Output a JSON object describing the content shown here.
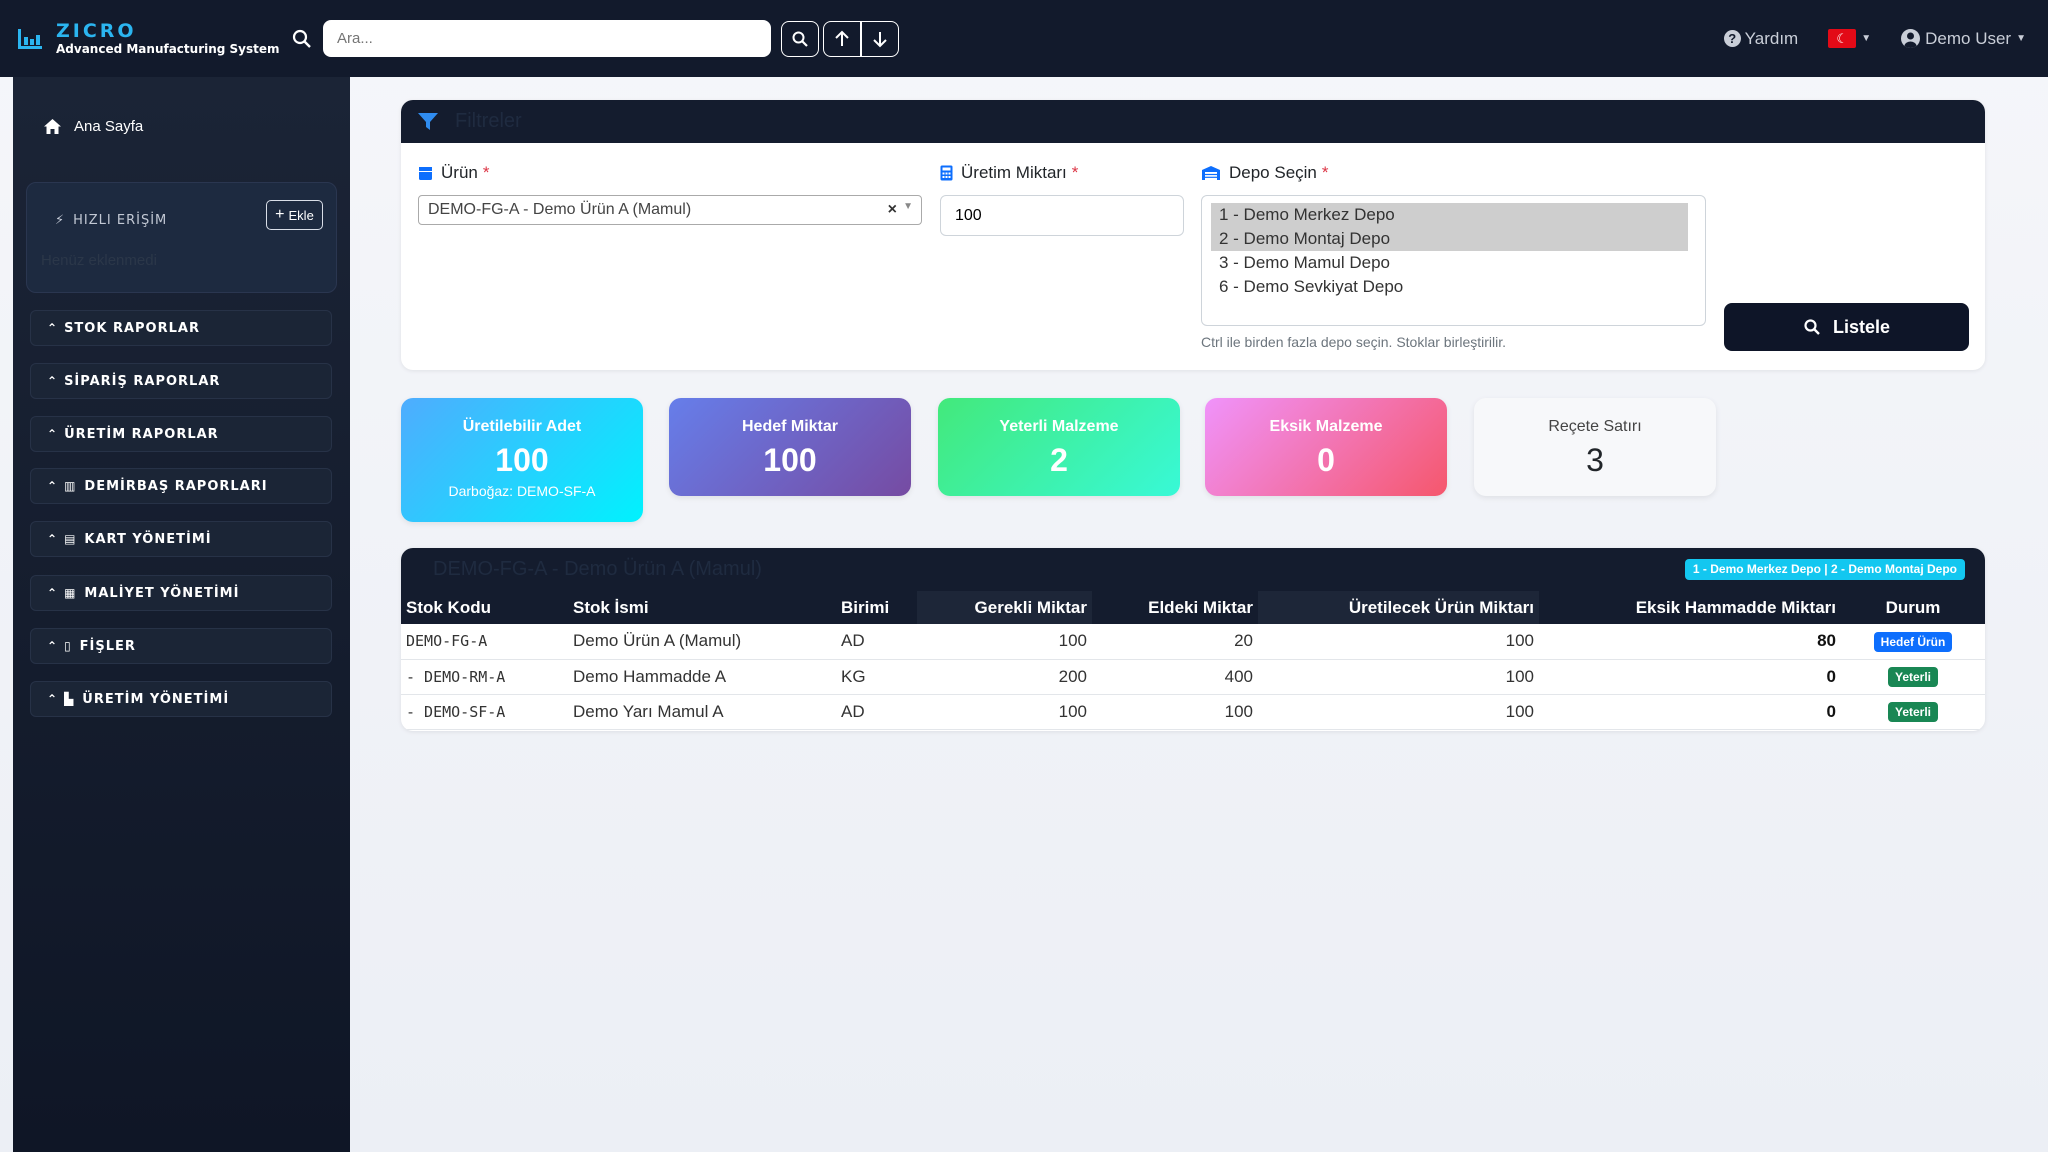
{
  "app": {
    "name": "ZICRO",
    "subtitle": "Advanced Manufacturing System"
  },
  "search": {
    "placeholder": "Ara..."
  },
  "topbar": {
    "help": "Yardım",
    "user": "Demo User",
    "language_flag": "TR"
  },
  "sidebar": {
    "home": "Ana Sayfa",
    "quick_access": {
      "title": "HIZLI ERİŞİM",
      "add_label": "Ekle",
      "empty_text": "Henüz eklenmedi"
    },
    "menus": [
      {
        "label": "STOK RAPORLAR"
      },
      {
        "label": "SİPARİŞ RAPORLAR"
      },
      {
        "label": "ÜRETİM RAPORLAR"
      },
      {
        "label": "DEMİRBAŞ RAPORLARI"
      },
      {
        "label": "KART YÖNETİMİ"
      },
      {
        "label": "MALİYET YÖNETİMİ"
      },
      {
        "label": "FİŞLER"
      },
      {
        "label": "ÜRETİM YÖNETİMİ"
      }
    ]
  },
  "filters": {
    "title": "Filtreler",
    "product_label": "Ürün",
    "product_value": "DEMO-FG-A - Demo Ürün A (Mamul)",
    "qty_label": "Üretim Miktarı",
    "qty_value": "100",
    "depot_label": "Depo Seçin",
    "depots": [
      "1 - Demo Merkez Depo",
      "2 - Demo Montaj Depo",
      "3 - Demo Mamul Depo",
      "6 - Demo Sevkiyat Depo"
    ],
    "hint": "Ctrl ile birden fazla depo seçin. Stoklar birleştirilir.",
    "list_button": "Listele"
  },
  "cards": [
    {
      "label": "Üretilebilir Adet",
      "value": "100",
      "sub": "Darboğaz: DEMO-SF-A"
    },
    {
      "label": "Hedef Miktar",
      "value": "100"
    },
    {
      "label": "Yeterli Malzeme",
      "value": "2"
    },
    {
      "label": "Eksik Malzeme",
      "value": "0"
    },
    {
      "label": "Reçete Satırı",
      "value": "3"
    }
  ],
  "result": {
    "title": "DEMO-FG-A - Demo Ürün A (Mamul)",
    "depot_badge": "1 - Demo Merkez Depo | 2 - Demo Montaj Depo",
    "columns": [
      "Stok Kodu",
      "Stok İsmi",
      "Birimi",
      "Gerekli Miktar",
      "Eldeki Miktar",
      "Üretilecek Ürün Miktarı",
      "Eksik Hammadde Miktarı",
      "Durum"
    ],
    "rows": [
      {
        "code": "DEMO-FG-A",
        "name": "Demo Ürün A (Mamul)",
        "unit": "AD",
        "required": "100",
        "onhand": "20",
        "producible": "100",
        "missing": "80",
        "status": "Hedef Ürün"
      },
      {
        "code": "- DEMO-RM-A",
        "name": "Demo Hammadde A",
        "unit": "KG",
        "required": "200",
        "onhand": "400",
        "producible": "100",
        "missing": "0",
        "status": "Yeterli"
      },
      {
        "code": "- DEMO-SF-A",
        "name": "Demo Yarı Mamul A",
        "unit": "AD",
        "required": "100",
        "onhand": "100",
        "producible": "100",
        "missing": "0",
        "status": "Yeterli"
      }
    ]
  }
}
